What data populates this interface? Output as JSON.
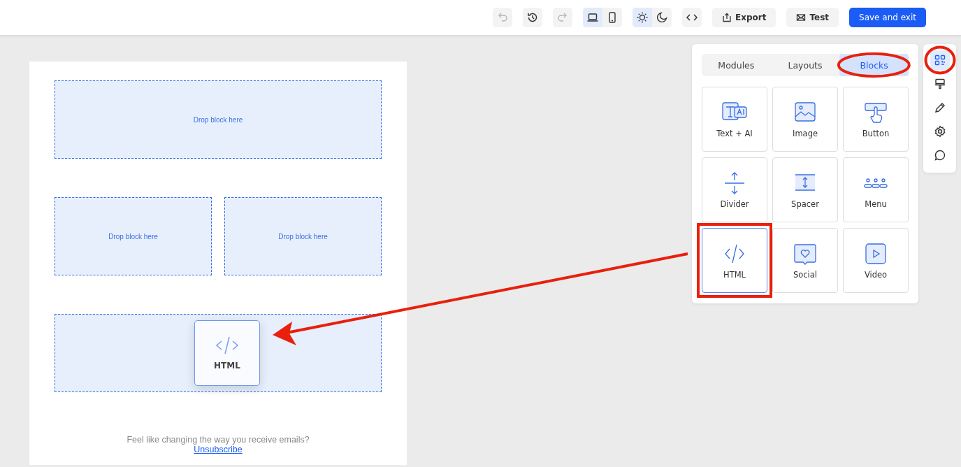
{
  "toolbar": {
    "history_buttons": [
      {
        "kind": "undo",
        "disabled": true
      },
      {
        "kind": "history",
        "disabled": false
      },
      {
        "kind": "redo",
        "disabled": true
      }
    ],
    "device_toggle": [
      {
        "kind": "desktop",
        "selected": true
      },
      {
        "kind": "mobile",
        "selected": false
      }
    ],
    "theme_toggle": [
      {
        "kind": "light",
        "selected": true
      },
      {
        "kind": "dark",
        "selected": false
      }
    ],
    "actions": [
      {
        "kind": "export",
        "label": "Export"
      },
      {
        "kind": "test",
        "label": "Test"
      },
      {
        "kind": "primary",
        "label": "Save and exit"
      }
    ]
  },
  "email": {
    "rows": [
      {
        "zones": [
          {
            "label": "Drop block here"
          }
        ]
      },
      {
        "zones": [
          {
            "label": "Drop block here"
          },
          {
            "label": "Drop block here"
          }
        ]
      },
      {
        "zones": [
          {
            "dragged_block": {
              "kind": "html",
              "label": "HTML"
            }
          }
        ]
      }
    ],
    "footer": {
      "text": "Feel like changing the way you receive emails?",
      "link": "Unsubscribe"
    }
  },
  "panel": {
    "tabs": [
      {
        "label": "Modules",
        "selected": false
      },
      {
        "label": "Layouts",
        "selected": false
      },
      {
        "label": "Blocks",
        "selected": true
      }
    ],
    "blocks": [
      {
        "kind": "text_ai",
        "label": "Text + AI",
        "selected": false
      },
      {
        "kind": "image",
        "label": "Image",
        "selected": false
      },
      {
        "kind": "button",
        "label": "Button",
        "selected": false
      },
      {
        "kind": "divider",
        "label": "Divider",
        "selected": false
      },
      {
        "kind": "spacer",
        "label": "Spacer",
        "selected": false
      },
      {
        "kind": "menu",
        "label": "Menu",
        "selected": false
      },
      {
        "kind": "html",
        "label": "HTML",
        "selected": true
      },
      {
        "kind": "social",
        "label": "Social",
        "selected": false
      },
      {
        "kind": "video",
        "label": "Video",
        "selected": false
      }
    ]
  },
  "rail": [
    {
      "kind": "blocks",
      "selected": true
    },
    {
      "kind": "style",
      "selected": false
    },
    {
      "kind": "edit",
      "selected": false
    },
    {
      "kind": "settings",
      "selected": false
    },
    {
      "kind": "comments",
      "selected": false
    }
  ]
}
